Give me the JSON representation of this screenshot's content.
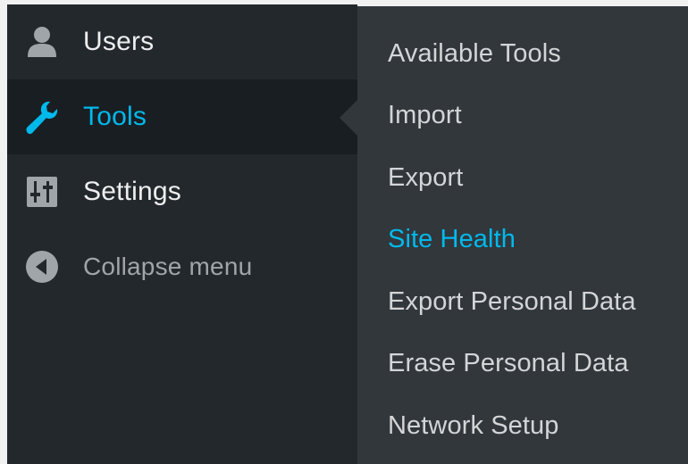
{
  "sidebar": {
    "items": [
      {
        "label": "Users",
        "icon": "user-icon",
        "current": false
      },
      {
        "label": "Tools",
        "icon": "wrench-icon",
        "current": true
      },
      {
        "label": "Settings",
        "icon": "settings-sliders-icon",
        "current": false
      },
      {
        "label": "Collapse menu",
        "icon": "collapse-arrow-icon",
        "current": false
      }
    ]
  },
  "submenu": {
    "items": [
      {
        "label": "Available Tools",
        "active": false
      },
      {
        "label": "Import",
        "active": false
      },
      {
        "label": "Export",
        "active": false
      },
      {
        "label": "Site Health",
        "active": true
      },
      {
        "label": "Export Personal Data",
        "active": false
      },
      {
        "label": "Erase Personal Data",
        "active": false
      },
      {
        "label": "Network Setup",
        "active": false
      }
    ]
  },
  "colors": {
    "sidebar_bg": "#23282d",
    "current_bg": "#191e23",
    "submenu_bg": "#32373c",
    "accent": "#00b9eb",
    "text": "#eeeeee",
    "muted_text": "#a0a5aa"
  }
}
